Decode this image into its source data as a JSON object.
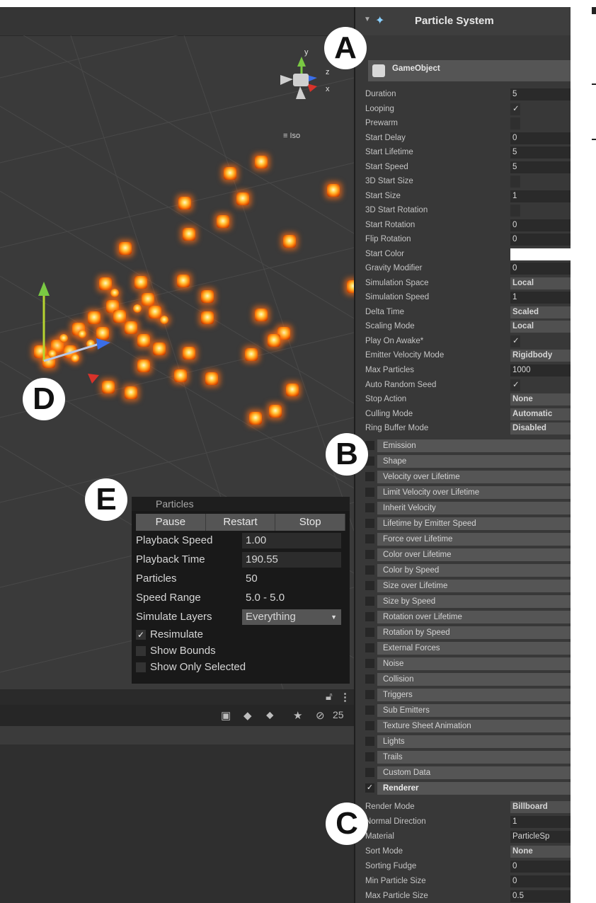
{
  "scene": {
    "iso_label": "Iso",
    "gizmo": {
      "y": "y",
      "z": "z",
      "x": "x"
    }
  },
  "inspector": {
    "component_title": "Particle System",
    "game_object_name": "GameObject",
    "properties": [
      {
        "label": "Duration",
        "value": "5"
      },
      {
        "label": "Looping",
        "value": "✓"
      },
      {
        "label": "Prewarm",
        "value": ""
      },
      {
        "label": "Start Delay",
        "value": "0"
      },
      {
        "label": "Start Lifetime",
        "value": "5"
      },
      {
        "label": "Start Speed",
        "value": "5"
      },
      {
        "label": "3D Start Size",
        "value": ""
      },
      {
        "label": "Start Size",
        "value": "1"
      },
      {
        "label": "3D Start Rotation",
        "value": ""
      },
      {
        "label": "Start Rotation",
        "value": "0"
      },
      {
        "label": "Flip Rotation",
        "value": "0"
      },
      {
        "label": "Start Color",
        "value": ""
      },
      {
        "label": "Gravity Modifier",
        "value": "0"
      },
      {
        "label": "Simulation Space",
        "value": "Local"
      },
      {
        "label": "Simulation Speed",
        "value": "1"
      },
      {
        "label": "Delta Time",
        "value": "Scaled"
      },
      {
        "label": "Scaling Mode",
        "value": "Local"
      },
      {
        "label": "Play On Awake*",
        "value": "✓"
      },
      {
        "label": "Emitter Velocity Mode",
        "value": "Rigidbody"
      },
      {
        "label": "Max Particles",
        "value": "1000"
      },
      {
        "label": "Auto Random Seed",
        "value": "✓"
      },
      {
        "label": "Stop Action",
        "value": "None"
      },
      {
        "label": "Culling Mode",
        "value": "Automatic"
      },
      {
        "label": "Ring Buffer Mode",
        "value": "Disabled"
      }
    ],
    "modules": [
      {
        "label": "Emission",
        "checked": ""
      },
      {
        "label": "Shape",
        "checked": ""
      },
      {
        "label": "Velocity over Lifetime",
        "checked": ""
      },
      {
        "label": "Limit Velocity over Lifetime",
        "checked": ""
      },
      {
        "label": "Inherit Velocity",
        "checked": ""
      },
      {
        "label": "Lifetime by Emitter Speed",
        "checked": ""
      },
      {
        "label": "Force over Lifetime",
        "checked": ""
      },
      {
        "label": "Color over Lifetime",
        "checked": ""
      },
      {
        "label": "Color by Speed",
        "checked": ""
      },
      {
        "label": "Size over Lifetime",
        "checked": ""
      },
      {
        "label": "Size by Speed",
        "checked": ""
      },
      {
        "label": "Rotation over Lifetime",
        "checked": ""
      },
      {
        "label": "Rotation by Speed",
        "checked": ""
      },
      {
        "label": "External Forces",
        "checked": ""
      },
      {
        "label": "Noise",
        "checked": ""
      },
      {
        "label": "Collision",
        "checked": ""
      },
      {
        "label": "Triggers",
        "checked": ""
      },
      {
        "label": "Sub Emitters",
        "checked": ""
      },
      {
        "label": "Texture Sheet Animation",
        "checked": ""
      },
      {
        "label": "Lights",
        "checked": ""
      },
      {
        "label": "Trails",
        "checked": ""
      },
      {
        "label": "Custom Data",
        "checked": ""
      },
      {
        "label": "Renderer",
        "checked": "✓"
      }
    ],
    "renderer": [
      {
        "label": "Render Mode",
        "value": "Billboard"
      },
      {
        "label": "Normal Direction",
        "value": "1"
      },
      {
        "label": "Material",
        "value": "ParticleSp"
      },
      {
        "label": "Sort Mode",
        "value": "None"
      },
      {
        "label": "Sorting Fudge",
        "value": "0"
      },
      {
        "label": "Min Particle Size",
        "value": "0"
      },
      {
        "label": "Max Particle Size",
        "value": "0.5"
      }
    ]
  },
  "overlay": {
    "title": "Particles",
    "buttons": {
      "pause": "Pause",
      "restart": "Restart",
      "stop": "Stop"
    },
    "playback_speed": {
      "label": "Playback Speed",
      "value": "1.00"
    },
    "playback_time": {
      "label": "Playback Time",
      "value": "190.55"
    },
    "particles": {
      "label": "Particles",
      "value": "50"
    },
    "speed_range": {
      "label": "Speed Range",
      "value": "5.0 - 5.0"
    },
    "simulate_layers": {
      "label": "Simulate Layers",
      "value": "Everything"
    },
    "resimulate": {
      "label": "Resimulate",
      "checked": "✓"
    },
    "show_bounds": {
      "label": "Show Bounds",
      "checked": ""
    },
    "show_only_selected": {
      "label": "Show Only Selected",
      "checked": ""
    }
  },
  "toolbar": {
    "lock_icon": "lock-icon",
    "menu_icon": "kebab-menu-icon",
    "visibility_count": "25"
  },
  "callouts": {
    "a": "A",
    "b": "B",
    "c": "C",
    "d": "D",
    "e": "E"
  },
  "colors": {
    "particle_glow": "#ff8a10",
    "inspector_bg": "#383838",
    "scene_bg": "#3a3a3a",
    "gizmo_y": "#7ac943",
    "gizmo_z": "#3a6ee8",
    "gizmo_x": "#d8322a"
  }
}
